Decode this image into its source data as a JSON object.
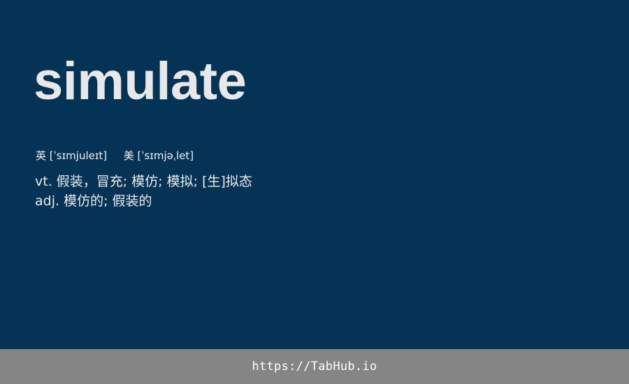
{
  "word": "simulate",
  "phonetics": {
    "uk_label": "英",
    "uk_ipa": "[ˈsɪmjuleɪt]",
    "us_label": "美",
    "us_ipa": "[ˈsɪmjəˌlet]"
  },
  "definitions": [
    {
      "pos": "vt.",
      "meaning": "假装，冒充; 模仿; 模拟; [生]拟态"
    },
    {
      "pos": "adj.",
      "meaning": "模仿的; 假装的"
    }
  ],
  "footer": {
    "link_text": "https://TabHub.io"
  },
  "colors": {
    "background": "#053355",
    "footer_background": "#858585",
    "word_text": "#e8e8e8"
  }
}
